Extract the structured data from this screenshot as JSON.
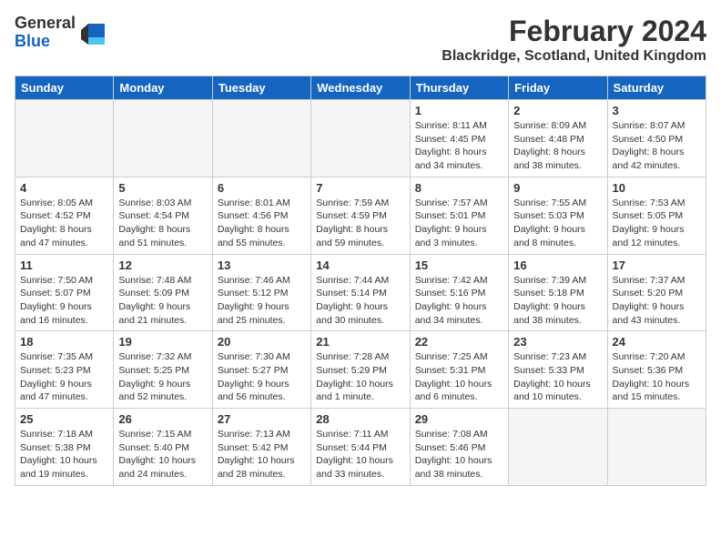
{
  "logo": {
    "general": "General",
    "blue": "Blue"
  },
  "title": "February 2024",
  "subtitle": "Blackridge, Scotland, United Kingdom",
  "days_of_week": [
    "Sunday",
    "Monday",
    "Tuesday",
    "Wednesday",
    "Thursday",
    "Friday",
    "Saturday"
  ],
  "weeks": [
    [
      {
        "day": "",
        "info": ""
      },
      {
        "day": "",
        "info": ""
      },
      {
        "day": "",
        "info": ""
      },
      {
        "day": "",
        "info": ""
      },
      {
        "day": "1",
        "info": "Sunrise: 8:11 AM\nSunset: 4:45 PM\nDaylight: 8 hours\nand 34 minutes."
      },
      {
        "day": "2",
        "info": "Sunrise: 8:09 AM\nSunset: 4:48 PM\nDaylight: 8 hours\nand 38 minutes."
      },
      {
        "day": "3",
        "info": "Sunrise: 8:07 AM\nSunset: 4:50 PM\nDaylight: 8 hours\nand 42 minutes."
      }
    ],
    [
      {
        "day": "4",
        "info": "Sunrise: 8:05 AM\nSunset: 4:52 PM\nDaylight: 8 hours\nand 47 minutes."
      },
      {
        "day": "5",
        "info": "Sunrise: 8:03 AM\nSunset: 4:54 PM\nDaylight: 8 hours\nand 51 minutes."
      },
      {
        "day": "6",
        "info": "Sunrise: 8:01 AM\nSunset: 4:56 PM\nDaylight: 8 hours\nand 55 minutes."
      },
      {
        "day": "7",
        "info": "Sunrise: 7:59 AM\nSunset: 4:59 PM\nDaylight: 8 hours\nand 59 minutes."
      },
      {
        "day": "8",
        "info": "Sunrise: 7:57 AM\nSunset: 5:01 PM\nDaylight: 9 hours\nand 3 minutes."
      },
      {
        "day": "9",
        "info": "Sunrise: 7:55 AM\nSunset: 5:03 PM\nDaylight: 9 hours\nand 8 minutes."
      },
      {
        "day": "10",
        "info": "Sunrise: 7:53 AM\nSunset: 5:05 PM\nDaylight: 9 hours\nand 12 minutes."
      }
    ],
    [
      {
        "day": "11",
        "info": "Sunrise: 7:50 AM\nSunset: 5:07 PM\nDaylight: 9 hours\nand 16 minutes."
      },
      {
        "day": "12",
        "info": "Sunrise: 7:48 AM\nSunset: 5:09 PM\nDaylight: 9 hours\nand 21 minutes."
      },
      {
        "day": "13",
        "info": "Sunrise: 7:46 AM\nSunset: 5:12 PM\nDaylight: 9 hours\nand 25 minutes."
      },
      {
        "day": "14",
        "info": "Sunrise: 7:44 AM\nSunset: 5:14 PM\nDaylight: 9 hours\nand 30 minutes."
      },
      {
        "day": "15",
        "info": "Sunrise: 7:42 AM\nSunset: 5:16 PM\nDaylight: 9 hours\nand 34 minutes."
      },
      {
        "day": "16",
        "info": "Sunrise: 7:39 AM\nSunset: 5:18 PM\nDaylight: 9 hours\nand 38 minutes."
      },
      {
        "day": "17",
        "info": "Sunrise: 7:37 AM\nSunset: 5:20 PM\nDaylight: 9 hours\nand 43 minutes."
      }
    ],
    [
      {
        "day": "18",
        "info": "Sunrise: 7:35 AM\nSunset: 5:23 PM\nDaylight: 9 hours\nand 47 minutes."
      },
      {
        "day": "19",
        "info": "Sunrise: 7:32 AM\nSunset: 5:25 PM\nDaylight: 9 hours\nand 52 minutes."
      },
      {
        "day": "20",
        "info": "Sunrise: 7:30 AM\nSunset: 5:27 PM\nDaylight: 9 hours\nand 56 minutes."
      },
      {
        "day": "21",
        "info": "Sunrise: 7:28 AM\nSunset: 5:29 PM\nDaylight: 10 hours\nand 1 minute."
      },
      {
        "day": "22",
        "info": "Sunrise: 7:25 AM\nSunset: 5:31 PM\nDaylight: 10 hours\nand 6 minutes."
      },
      {
        "day": "23",
        "info": "Sunrise: 7:23 AM\nSunset: 5:33 PM\nDaylight: 10 hours\nand 10 minutes."
      },
      {
        "day": "24",
        "info": "Sunrise: 7:20 AM\nSunset: 5:36 PM\nDaylight: 10 hours\nand 15 minutes."
      }
    ],
    [
      {
        "day": "25",
        "info": "Sunrise: 7:18 AM\nSunset: 5:38 PM\nDaylight: 10 hours\nand 19 minutes."
      },
      {
        "day": "26",
        "info": "Sunrise: 7:15 AM\nSunset: 5:40 PM\nDaylight: 10 hours\nand 24 minutes."
      },
      {
        "day": "27",
        "info": "Sunrise: 7:13 AM\nSunset: 5:42 PM\nDaylight: 10 hours\nand 28 minutes."
      },
      {
        "day": "28",
        "info": "Sunrise: 7:11 AM\nSunset: 5:44 PM\nDaylight: 10 hours\nand 33 minutes."
      },
      {
        "day": "29",
        "info": "Sunrise: 7:08 AM\nSunset: 5:46 PM\nDaylight: 10 hours\nand 38 minutes."
      },
      {
        "day": "",
        "info": ""
      },
      {
        "day": "",
        "info": ""
      }
    ]
  ]
}
